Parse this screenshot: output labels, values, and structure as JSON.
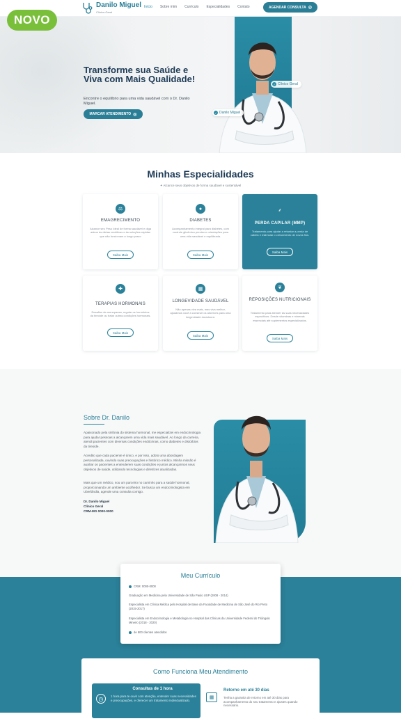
{
  "badge": "NOVO",
  "header": {
    "logo_name": "Danilo Miguel",
    "logo_sub": "Clínica Geral",
    "nav": [
      "Início",
      "Sobre mim",
      "Currículo",
      "Especialidades",
      "Contato"
    ],
    "cta": "AGENDAR CONSULTA"
  },
  "hero": {
    "title": "Transforme sua Saúde e Viva com Mais Qualidade!",
    "subtitle": "Encontre o equilíbrio para uma vida saudável com o Dr. Danilo Miguel.",
    "button": "MARCAR ATENDIMENTO",
    "tag_specialty": "Clínico Geral",
    "tag_name": "Danilo Miguel"
  },
  "specialties": {
    "title": "Minhas Especialidades",
    "subtitle": "Alcance seus objetivos de forma saudável e sustentável",
    "cards": [
      {
        "title": "EMAGRECIMENTO",
        "desc": "Alcance seu Peso Ideal de forma saudável e diga adeus às dietas restritivas e às soluções rápidas que não funcionam a longo prazo",
        "button": "Saiba Mais",
        "icon": "scale-icon"
      },
      {
        "title": "DIABETES",
        "desc": "Acompanhamento integral para diabetes, com controle glicêmico preciso e orientações para uma vida saudável e equilibrada.",
        "button": "Saiba Mais",
        "icon": "drop-icon"
      },
      {
        "title": "PERDA CAPILAR (MMP)",
        "desc": "Tratamento para ajudar a retardar a perda de cabelo e estimular o crescimento de novos fios.",
        "button": "Saiba Mais",
        "icon": "hair-icon"
      },
      {
        "title": "TERAPIAS HORMONAIS",
        "desc": "Desafios da menopausa, regular os hormônios da tireoide ou tratar outras condições hormonais.",
        "button": "Saiba Mais",
        "icon": "hormone-icon"
      },
      {
        "title": "LONGEVIDADE SAUDÁVEL",
        "desc": "Não apenas viva mais, mas viva melhor, ajudamos você a construir os alicerces para uma longevidade duradoura.",
        "button": "Saiba Mais",
        "icon": "calendar-icon"
      },
      {
        "title": "REPOSIÇÕES NUTRICIONAIS",
        "desc": "Tratamento para atender às suas necessidades específicas. Desde vitaminas e minerais essenciais até suplementos especializados.",
        "button": "Saiba Mais",
        "icon": "nutrition-icon"
      }
    ]
  },
  "about": {
    "title": "Sobre Dr. Danilo",
    "p1": "Apaixonado pela sinfonia do sistema hormonal, me especializei em endocrinologia para ajudar pessoas a alcançarem uma vida mais saudável. Ao longo da carreira, atendi pacientes com diversas condições endócrinas, como diabetes e distúrbios da tireoide.",
    "p2": "Acredito que cada paciente é único, e por isso, adoto uma abordagem personalizada, ouvindo suas preocupações e histórico médico. Minha missão é auxiliar os pacientes a entenderem suas condições e juntos alcançarmos seus objetivos de saúde, utilizando tecnologias e diretrizes atualizadas.",
    "p3": "Mais que um médico, sou um parceiro no caminho para a saúde hormonal, proporcionando um ambiente acolhedor. Se busca um endocrinologista em Uberlândia, agende uma consulta comigo.",
    "sign_name": "Dr. Danilo Miguel",
    "sign_role": "Clínico Geral",
    "sign_crm": "CRM-MG 0000-0000"
  },
  "curriculum": {
    "title": "Meu Currículo",
    "crm": "CRM: 0000-0000",
    "items": [
      "Graduação em Medicina pela Universidade de São Paulo USP (2008 - 2014)",
      "Especialista em Clínica Médica pelo Hospital de Base da Faculdade de Medicina de São José do Rio Preto (2015-2017)",
      "Especialista em Endocrinologia e Metabologia no Hospital das Clínicas da Universidade Federal do Triângulo Mineiro (2018 - 2020)"
    ],
    "patients": "de 800 clientes atendidos"
  },
  "how": {
    "title": "Como Funciona Meu Atendimento",
    "a_title": "Consultas de 1 hora",
    "a_desc": "1 hora para te ouvir com atenção, entender suas necessidades e preocupações, e oferecer um tratamento individualizado.",
    "b_title": "Retorno em até 30 dias",
    "b_desc": "Tenha a garantia de retorno em até 30 dias para acompanhamento do seu tratamento e ajustes quando necessário."
  },
  "colors": {
    "primary": "#2a8199",
    "dark": "#1d3a55",
    "badge": "#79bf3a"
  }
}
